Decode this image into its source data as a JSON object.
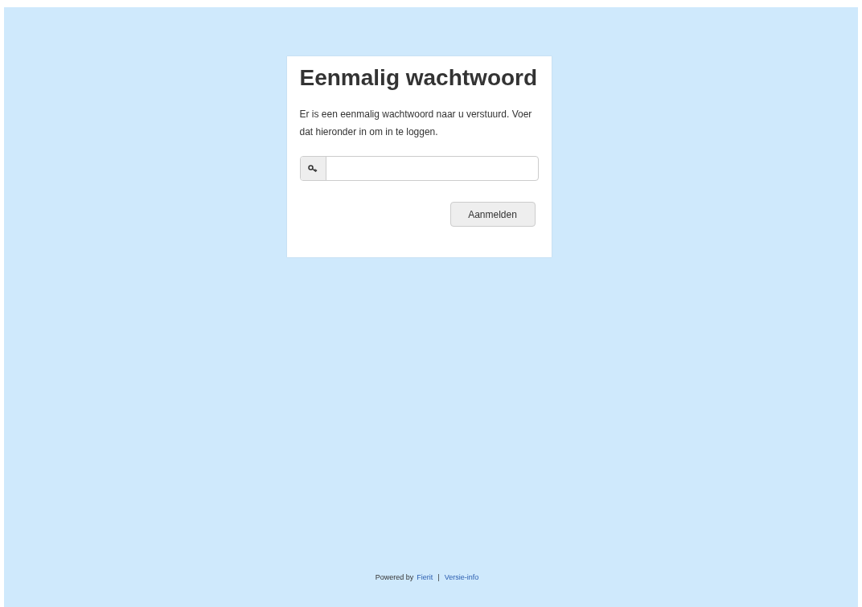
{
  "title": "Eenmalig wachtwoord",
  "message": "Er is een eenmalig wachtwoord naar u verstuurd. Voer dat hieronder in om in te loggen.",
  "submit_button": "Aanmelden",
  "footer": {
    "prefix": "Powered by",
    "links": [
      "Fierit",
      "Versie-info"
    ],
    "separator": "|"
  }
}
